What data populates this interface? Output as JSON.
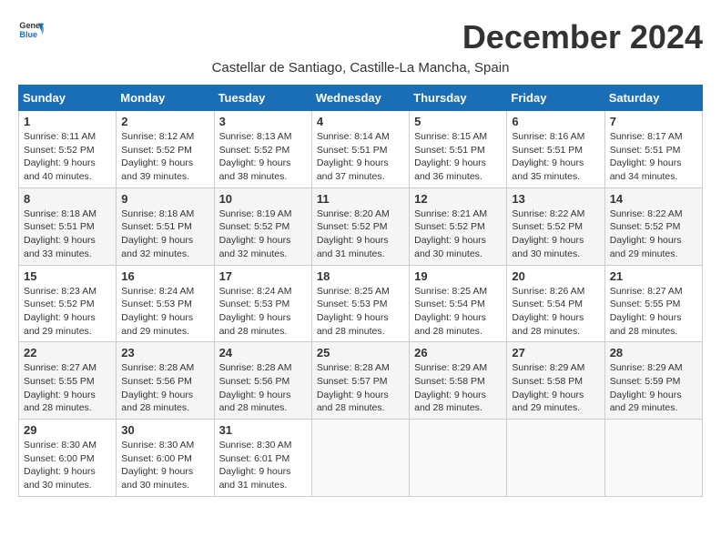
{
  "logo": {
    "line1": "General",
    "line2": "Blue"
  },
  "title": "December 2024",
  "subtitle": "Castellar de Santiago, Castille-La Mancha, Spain",
  "headers": [
    "Sunday",
    "Monday",
    "Tuesday",
    "Wednesday",
    "Thursday",
    "Friday",
    "Saturday"
  ],
  "weeks": [
    [
      {
        "day": "1",
        "rise": "8:11 AM",
        "set": "5:52 PM",
        "daylight": "9 hours and 40 minutes."
      },
      {
        "day": "2",
        "rise": "8:12 AM",
        "set": "5:52 PM",
        "daylight": "9 hours and 39 minutes."
      },
      {
        "day": "3",
        "rise": "8:13 AM",
        "set": "5:52 PM",
        "daylight": "9 hours and 38 minutes."
      },
      {
        "day": "4",
        "rise": "8:14 AM",
        "set": "5:51 PM",
        "daylight": "9 hours and 37 minutes."
      },
      {
        "day": "5",
        "rise": "8:15 AM",
        "set": "5:51 PM",
        "daylight": "9 hours and 36 minutes."
      },
      {
        "day": "6",
        "rise": "8:16 AM",
        "set": "5:51 PM",
        "daylight": "9 hours and 35 minutes."
      },
      {
        "day": "7",
        "rise": "8:17 AM",
        "set": "5:51 PM",
        "daylight": "9 hours and 34 minutes."
      }
    ],
    [
      {
        "day": "8",
        "rise": "8:18 AM",
        "set": "5:51 PM",
        "daylight": "9 hours and 33 minutes."
      },
      {
        "day": "9",
        "rise": "8:18 AM",
        "set": "5:51 PM",
        "daylight": "9 hours and 32 minutes."
      },
      {
        "day": "10",
        "rise": "8:19 AM",
        "set": "5:52 PM",
        "daylight": "9 hours and 32 minutes."
      },
      {
        "day": "11",
        "rise": "8:20 AM",
        "set": "5:52 PM",
        "daylight": "9 hours and 31 minutes."
      },
      {
        "day": "12",
        "rise": "8:21 AM",
        "set": "5:52 PM",
        "daylight": "9 hours and 30 minutes."
      },
      {
        "day": "13",
        "rise": "8:22 AM",
        "set": "5:52 PM",
        "daylight": "9 hours and 30 minutes."
      },
      {
        "day": "14",
        "rise": "8:22 AM",
        "set": "5:52 PM",
        "daylight": "9 hours and 29 minutes."
      }
    ],
    [
      {
        "day": "15",
        "rise": "8:23 AM",
        "set": "5:52 PM",
        "daylight": "9 hours and 29 minutes."
      },
      {
        "day": "16",
        "rise": "8:24 AM",
        "set": "5:53 PM",
        "daylight": "9 hours and 29 minutes."
      },
      {
        "day": "17",
        "rise": "8:24 AM",
        "set": "5:53 PM",
        "daylight": "9 hours and 28 minutes."
      },
      {
        "day": "18",
        "rise": "8:25 AM",
        "set": "5:53 PM",
        "daylight": "9 hours and 28 minutes."
      },
      {
        "day": "19",
        "rise": "8:25 AM",
        "set": "5:54 PM",
        "daylight": "9 hours and 28 minutes."
      },
      {
        "day": "20",
        "rise": "8:26 AM",
        "set": "5:54 PM",
        "daylight": "9 hours and 28 minutes."
      },
      {
        "day": "21",
        "rise": "8:27 AM",
        "set": "5:55 PM",
        "daylight": "9 hours and 28 minutes."
      }
    ],
    [
      {
        "day": "22",
        "rise": "8:27 AM",
        "set": "5:55 PM",
        "daylight": "9 hours and 28 minutes."
      },
      {
        "day": "23",
        "rise": "8:28 AM",
        "set": "5:56 PM",
        "daylight": "9 hours and 28 minutes."
      },
      {
        "day": "24",
        "rise": "8:28 AM",
        "set": "5:56 PM",
        "daylight": "9 hours and 28 minutes."
      },
      {
        "day": "25",
        "rise": "8:28 AM",
        "set": "5:57 PM",
        "daylight": "9 hours and 28 minutes."
      },
      {
        "day": "26",
        "rise": "8:29 AM",
        "set": "5:58 PM",
        "daylight": "9 hours and 28 minutes."
      },
      {
        "day": "27",
        "rise": "8:29 AM",
        "set": "5:58 PM",
        "daylight": "9 hours and 29 minutes."
      },
      {
        "day": "28",
        "rise": "8:29 AM",
        "set": "5:59 PM",
        "daylight": "9 hours and 29 minutes."
      }
    ],
    [
      {
        "day": "29",
        "rise": "8:30 AM",
        "set": "6:00 PM",
        "daylight": "9 hours and 30 minutes."
      },
      {
        "day": "30",
        "rise": "8:30 AM",
        "set": "6:00 PM",
        "daylight": "9 hours and 30 minutes."
      },
      {
        "day": "31",
        "rise": "8:30 AM",
        "set": "6:01 PM",
        "daylight": "9 hours and 31 minutes."
      },
      null,
      null,
      null,
      null
    ]
  ]
}
